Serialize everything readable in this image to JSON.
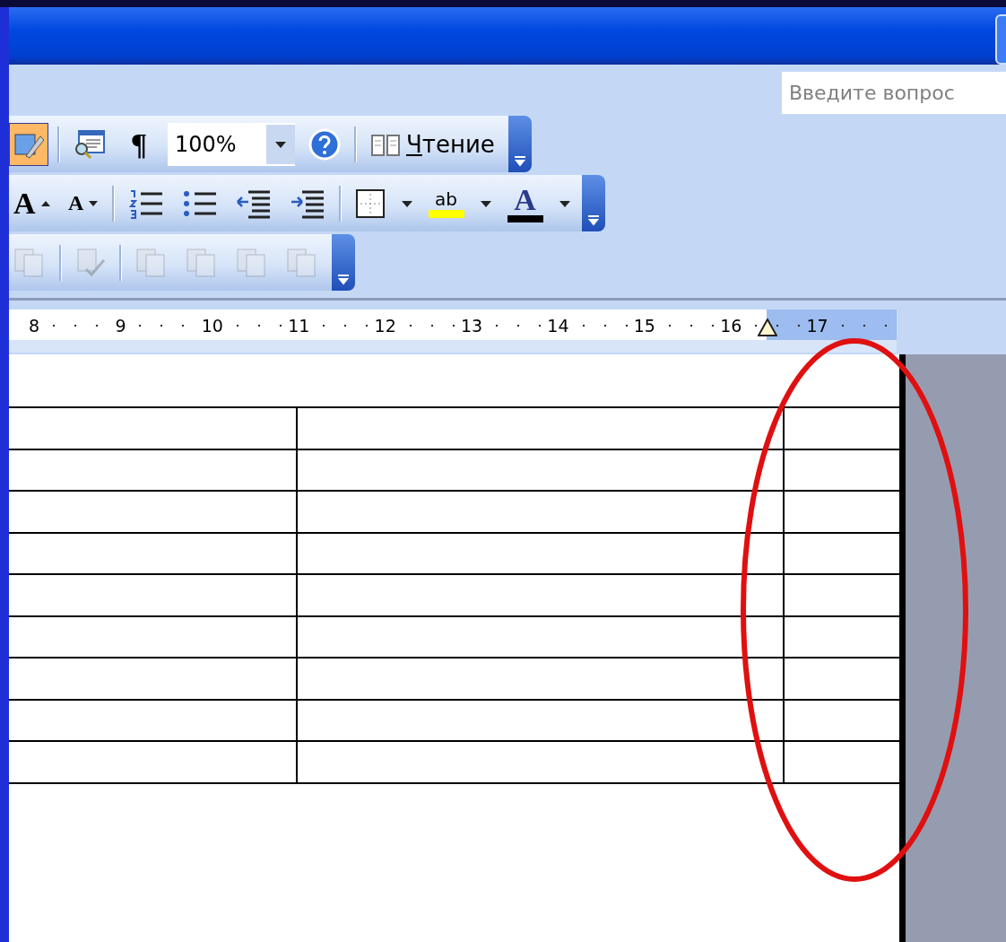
{
  "title_bar": {
    "kind": "titlebar"
  },
  "help_search": {
    "placeholder": "Введите вопрос"
  },
  "toolbars": [
    {
      "items": [
        {
          "kind": "spelling",
          "selected": true
        },
        {
          "kind": "separator"
        },
        {
          "kind": "docmap",
          "selected": false
        },
        {
          "kind": "marks",
          "label": "¶",
          "selected": false
        },
        {
          "kind": "zoom",
          "value": "100%"
        },
        {
          "kind": "help",
          "selected": false
        },
        {
          "kind": "separator"
        },
        {
          "kind": "reading",
          "label": "Чтение",
          "selected": false
        }
      ]
    },
    {
      "items": [
        {
          "kind": "grow",
          "label": "A"
        },
        {
          "kind": "shrink",
          "label": "A"
        },
        {
          "kind": "separator"
        },
        {
          "kind": "numbered"
        },
        {
          "kind": "bullets"
        },
        {
          "kind": "outdent"
        },
        {
          "kind": "indent"
        },
        {
          "kind": "separator"
        },
        {
          "kind": "borders"
        },
        {
          "kind": "dropdown"
        },
        {
          "kind": "highlight",
          "label": "ab"
        },
        {
          "kind": "dropdown"
        },
        {
          "kind": "fontcolor",
          "label": "A"
        },
        {
          "kind": "dropdown"
        }
      ]
    },
    {
      "items": [
        {
          "kind": "pages",
          "disabled": true
        },
        {
          "kind": "separator"
        },
        {
          "kind": "accept",
          "disabled": true
        },
        {
          "kind": "separator"
        },
        {
          "kind": "pages",
          "disabled": true
        },
        {
          "kind": "pages",
          "disabled": true
        },
        {
          "kind": "pages",
          "disabled": true
        },
        {
          "kind": "pages",
          "disabled": true
        }
      ]
    }
  ],
  "ruler": {
    "labels": [
      "8",
      "9",
      "10",
      "11",
      "12",
      "13",
      "14",
      "15",
      "16",
      "17"
    ]
  },
  "table": {
    "columns": [
      {
        "kind": "wide"
      },
      {
        "kind": "wider"
      },
      {
        "kind": "narrow"
      }
    ],
    "rows": [
      {
        "kind": "blank"
      },
      {
        "kind": "blank"
      },
      {
        "kind": "blank"
      },
      {
        "kind": "blank"
      },
      {
        "kind": "blank"
      },
      {
        "kind": "blank"
      },
      {
        "kind": "blank"
      },
      {
        "kind": "blank"
      },
      {
        "kind": "blank"
      }
    ]
  },
  "annotation": {
    "kind": "ellipse",
    "color": "#e01010"
  }
}
